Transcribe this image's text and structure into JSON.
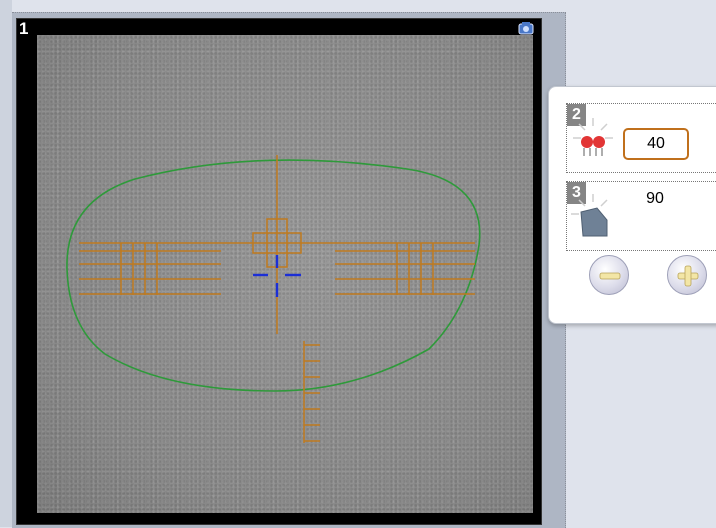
{
  "camera": {
    "corner_label": "1",
    "top_right_icon": "camera-icon"
  },
  "settings": {
    "row2": {
      "label": "2",
      "icon": "led-brightness-icon",
      "value": "40"
    },
    "row3": {
      "label": "3",
      "icon": "angle-icon",
      "value": "90"
    },
    "decrease_icon": "minus-icon",
    "increase_icon": "plus-icon"
  },
  "colors": {
    "lens_outline": "#2e9a3a",
    "reticle": "#c07a1e",
    "center_mark": "#1c2fd6",
    "value_border": "#c0701c",
    "button_accent": "#f3e6a6"
  }
}
